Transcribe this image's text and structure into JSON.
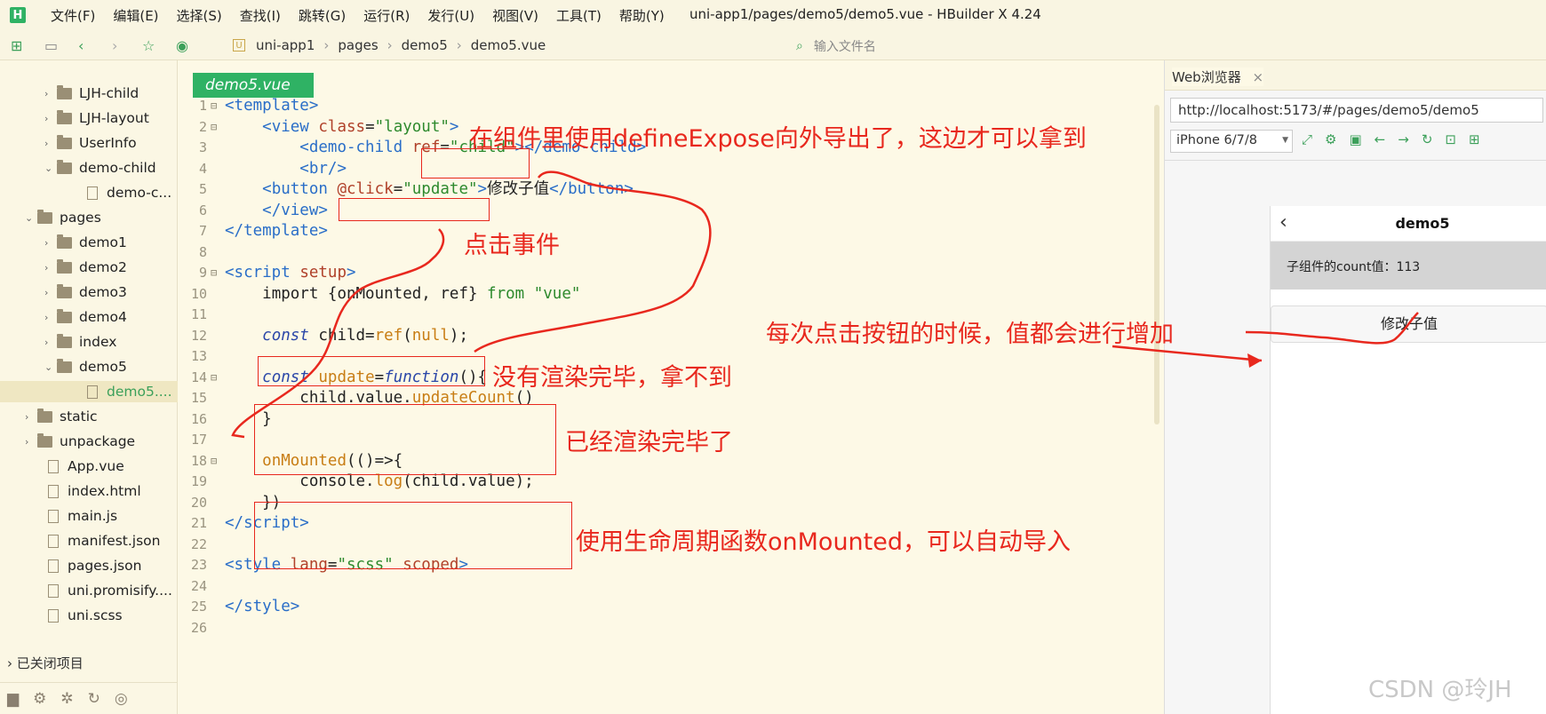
{
  "app": {
    "title": "uni-app1/pages/demo5/demo5.vue - HBuilder X 4.24",
    "logo": "H"
  },
  "menu": [
    "文件(F)",
    "编辑(E)",
    "选择(S)",
    "查找(I)",
    "跳转(G)",
    "运行(R)",
    "发行(U)",
    "视图(V)",
    "工具(T)",
    "帮助(Y)"
  ],
  "breadcrumb": [
    "uni-app1",
    "pages",
    "demo5",
    "demo5.vue"
  ],
  "file_search": {
    "placeholder": "输入文件名"
  },
  "tree": [
    {
      "label": "LJH-child",
      "type": "folder",
      "arrow": "›"
    },
    {
      "label": "LJH-layout",
      "type": "folder",
      "arrow": "›"
    },
    {
      "label": "UserInfo",
      "type": "folder",
      "arrow": "›"
    },
    {
      "label": "demo-child",
      "type": "folder",
      "arrow": "⌄"
    },
    {
      "label": "demo-c...",
      "type": "file",
      "arrow": ""
    },
    {
      "label": "pages",
      "type": "folder",
      "arrow": "⌄"
    },
    {
      "label": "demo1",
      "type": "folder",
      "arrow": "›"
    },
    {
      "label": "demo2",
      "type": "folder",
      "arrow": "›"
    },
    {
      "label": "demo3",
      "type": "folder",
      "arrow": "›"
    },
    {
      "label": "demo4",
      "type": "folder",
      "arrow": "›"
    },
    {
      "label": "index",
      "type": "folder",
      "arrow": "›"
    },
    {
      "label": "demo5",
      "type": "folder",
      "arrow": "⌄"
    },
    {
      "label": "demo5....",
      "type": "file",
      "arrow": ""
    },
    {
      "label": "static",
      "type": "folder",
      "arrow": "›"
    },
    {
      "label": "unpackage",
      "type": "folder",
      "arrow": "›"
    },
    {
      "label": "App.vue",
      "type": "file",
      "arrow": ""
    },
    {
      "label": "index.html",
      "type": "file",
      "arrow": ""
    },
    {
      "label": "main.js",
      "type": "file",
      "arrow": ""
    },
    {
      "label": "manifest.json",
      "type": "file",
      "arrow": ""
    },
    {
      "label": "pages.json",
      "type": "file",
      "arrow": ""
    },
    {
      "label": "uni.promisify....",
      "type": "file",
      "arrow": ""
    },
    {
      "label": "uni.scss",
      "type": "file",
      "arrow": ""
    }
  ],
  "closed_projects": "已关闭项目",
  "editor": {
    "tab": "demo5.vue",
    "line_numbers": [
      "1",
      "2",
      "3",
      "4",
      "5",
      "6",
      "7",
      "8",
      "9",
      "10",
      "11",
      "12",
      "13",
      "14",
      "15",
      "16",
      "17",
      "18",
      "19",
      "20",
      "21",
      "22",
      "23",
      "24",
      "25",
      "26"
    ]
  },
  "browser": {
    "tab": "Web浏览器",
    "url": "http://localhost:5173/#/pages/demo5/demo5",
    "device": "iPhone 6/7/8",
    "page_title": "demo5",
    "count_label": "子组件的count值：113",
    "button": "修改子值"
  },
  "annotations": {
    "a1": "在组件里使用defineExpose向外导出了，这边才可以拿到",
    "a2": "点击事件",
    "a3": "没有渲染完毕，拿不到",
    "a4": "已经渲染完毕了",
    "a5": "使用生命周期函数onMounted，可以自动导入",
    "a6": "每次点击按钮的时候，值都会进行增加"
  },
  "watermark": "CSDN @玲JH",
  "colors": {
    "accent": "#2fb264",
    "annotation": "#e8281e",
    "background": "#fdf9e6"
  }
}
